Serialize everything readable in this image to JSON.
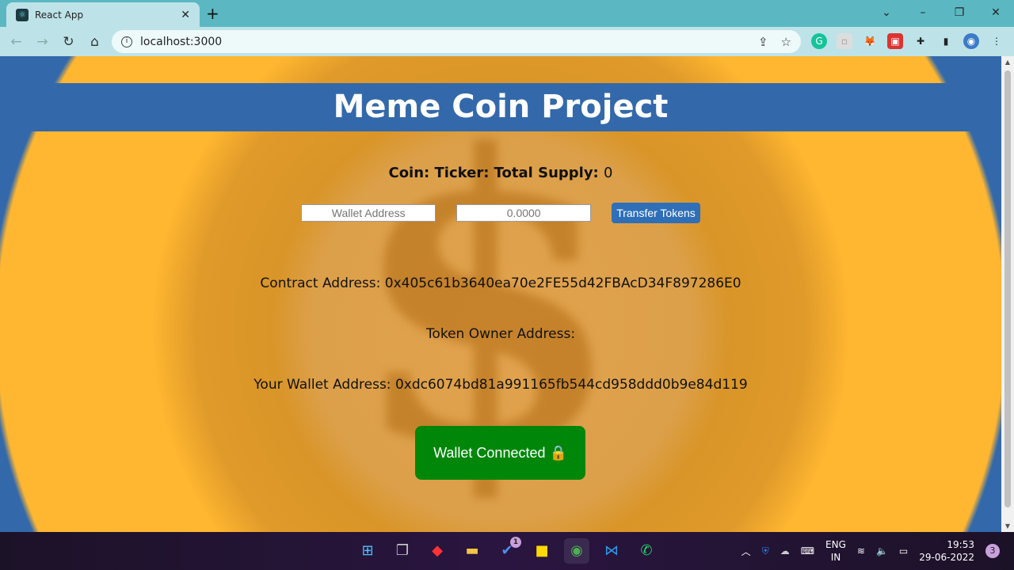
{
  "browser": {
    "tab_title": "React App",
    "url": "localhost:3000"
  },
  "page": {
    "title": "Meme Coin Project",
    "supply_label": "Coin: Ticker: Total Supply:",
    "supply_value": "0",
    "wallet_placeholder": "Wallet Address",
    "amount_placeholder": "0.0000",
    "transfer_label": "Transfer Tokens",
    "contract_address": "Contract Address: 0x405c61b3640ea70e2FE55d42FBAcD34F897286E0",
    "owner_address": "Token Owner Address:",
    "your_wallet": "Your Wallet Address: 0xdc6074bd81a991165fb544cd958ddd0b9e84d119",
    "wallet_button": "Wallet Connected 🔒"
  },
  "taskbar": {
    "lang1": "ENG",
    "lang2": "IN",
    "time": "19:53",
    "date": "29-06-2022",
    "notifications": "3",
    "todo_badge": "1"
  }
}
